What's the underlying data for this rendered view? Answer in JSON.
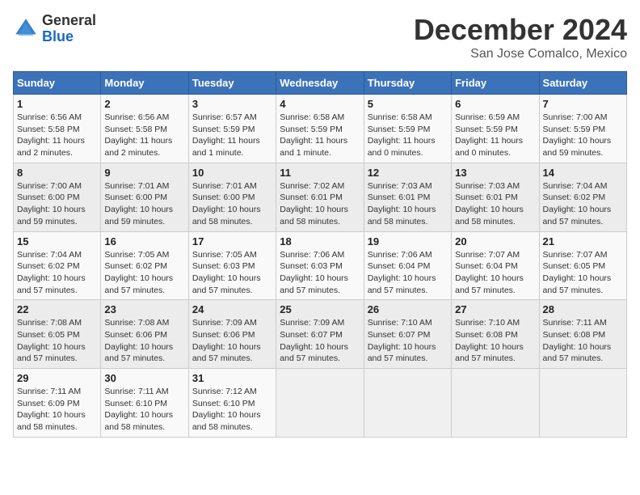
{
  "header": {
    "logo_general": "General",
    "logo_blue": "Blue",
    "month_title": "December 2024",
    "location": "San Jose Comalco, Mexico"
  },
  "weekdays": [
    "Sunday",
    "Monday",
    "Tuesday",
    "Wednesday",
    "Thursday",
    "Friday",
    "Saturday"
  ],
  "weeks": [
    [
      {
        "day": "1",
        "sunrise": "6:56 AM",
        "sunset": "5:58 PM",
        "daylight": "11 hours and 2 minutes."
      },
      {
        "day": "2",
        "sunrise": "6:56 AM",
        "sunset": "5:58 PM",
        "daylight": "11 hours and 2 minutes."
      },
      {
        "day": "3",
        "sunrise": "6:57 AM",
        "sunset": "5:59 PM",
        "daylight": "11 hours and 1 minute."
      },
      {
        "day": "4",
        "sunrise": "6:58 AM",
        "sunset": "5:59 PM",
        "daylight": "11 hours and 1 minute."
      },
      {
        "day": "5",
        "sunrise": "6:58 AM",
        "sunset": "5:59 PM",
        "daylight": "11 hours and 0 minutes."
      },
      {
        "day": "6",
        "sunrise": "6:59 AM",
        "sunset": "5:59 PM",
        "daylight": "11 hours and 0 minutes."
      },
      {
        "day": "7",
        "sunrise": "7:00 AM",
        "sunset": "5:59 PM",
        "daylight": "10 hours and 59 minutes."
      }
    ],
    [
      {
        "day": "8",
        "sunrise": "7:00 AM",
        "sunset": "6:00 PM",
        "daylight": "10 hours and 59 minutes."
      },
      {
        "day": "9",
        "sunrise": "7:01 AM",
        "sunset": "6:00 PM",
        "daylight": "10 hours and 59 minutes."
      },
      {
        "day": "10",
        "sunrise": "7:01 AM",
        "sunset": "6:00 PM",
        "daylight": "10 hours and 58 minutes."
      },
      {
        "day": "11",
        "sunrise": "7:02 AM",
        "sunset": "6:01 PM",
        "daylight": "10 hours and 58 minutes."
      },
      {
        "day": "12",
        "sunrise": "7:03 AM",
        "sunset": "6:01 PM",
        "daylight": "10 hours and 58 minutes."
      },
      {
        "day": "13",
        "sunrise": "7:03 AM",
        "sunset": "6:01 PM",
        "daylight": "10 hours and 58 minutes."
      },
      {
        "day": "14",
        "sunrise": "7:04 AM",
        "sunset": "6:02 PM",
        "daylight": "10 hours and 57 minutes."
      }
    ],
    [
      {
        "day": "15",
        "sunrise": "7:04 AM",
        "sunset": "6:02 PM",
        "daylight": "10 hours and 57 minutes."
      },
      {
        "day": "16",
        "sunrise": "7:05 AM",
        "sunset": "6:02 PM",
        "daylight": "10 hours and 57 minutes."
      },
      {
        "day": "17",
        "sunrise": "7:05 AM",
        "sunset": "6:03 PM",
        "daylight": "10 hours and 57 minutes."
      },
      {
        "day": "18",
        "sunrise": "7:06 AM",
        "sunset": "6:03 PM",
        "daylight": "10 hours and 57 minutes."
      },
      {
        "day": "19",
        "sunrise": "7:06 AM",
        "sunset": "6:04 PM",
        "daylight": "10 hours and 57 minutes."
      },
      {
        "day": "20",
        "sunrise": "7:07 AM",
        "sunset": "6:04 PM",
        "daylight": "10 hours and 57 minutes."
      },
      {
        "day": "21",
        "sunrise": "7:07 AM",
        "sunset": "6:05 PM",
        "daylight": "10 hours and 57 minutes."
      }
    ],
    [
      {
        "day": "22",
        "sunrise": "7:08 AM",
        "sunset": "6:05 PM",
        "daylight": "10 hours and 57 minutes."
      },
      {
        "day": "23",
        "sunrise": "7:08 AM",
        "sunset": "6:06 PM",
        "daylight": "10 hours and 57 minutes."
      },
      {
        "day": "24",
        "sunrise": "7:09 AM",
        "sunset": "6:06 PM",
        "daylight": "10 hours and 57 minutes."
      },
      {
        "day": "25",
        "sunrise": "7:09 AM",
        "sunset": "6:07 PM",
        "daylight": "10 hours and 57 minutes."
      },
      {
        "day": "26",
        "sunrise": "7:10 AM",
        "sunset": "6:07 PM",
        "daylight": "10 hours and 57 minutes."
      },
      {
        "day": "27",
        "sunrise": "7:10 AM",
        "sunset": "6:08 PM",
        "daylight": "10 hours and 57 minutes."
      },
      {
        "day": "28",
        "sunrise": "7:11 AM",
        "sunset": "6:08 PM",
        "daylight": "10 hours and 57 minutes."
      }
    ],
    [
      {
        "day": "29",
        "sunrise": "7:11 AM",
        "sunset": "6:09 PM",
        "daylight": "10 hours and 58 minutes."
      },
      {
        "day": "30",
        "sunrise": "7:11 AM",
        "sunset": "6:10 PM",
        "daylight": "10 hours and 58 minutes."
      },
      {
        "day": "31",
        "sunrise": "7:12 AM",
        "sunset": "6:10 PM",
        "daylight": "10 hours and 58 minutes."
      },
      null,
      null,
      null,
      null
    ]
  ]
}
